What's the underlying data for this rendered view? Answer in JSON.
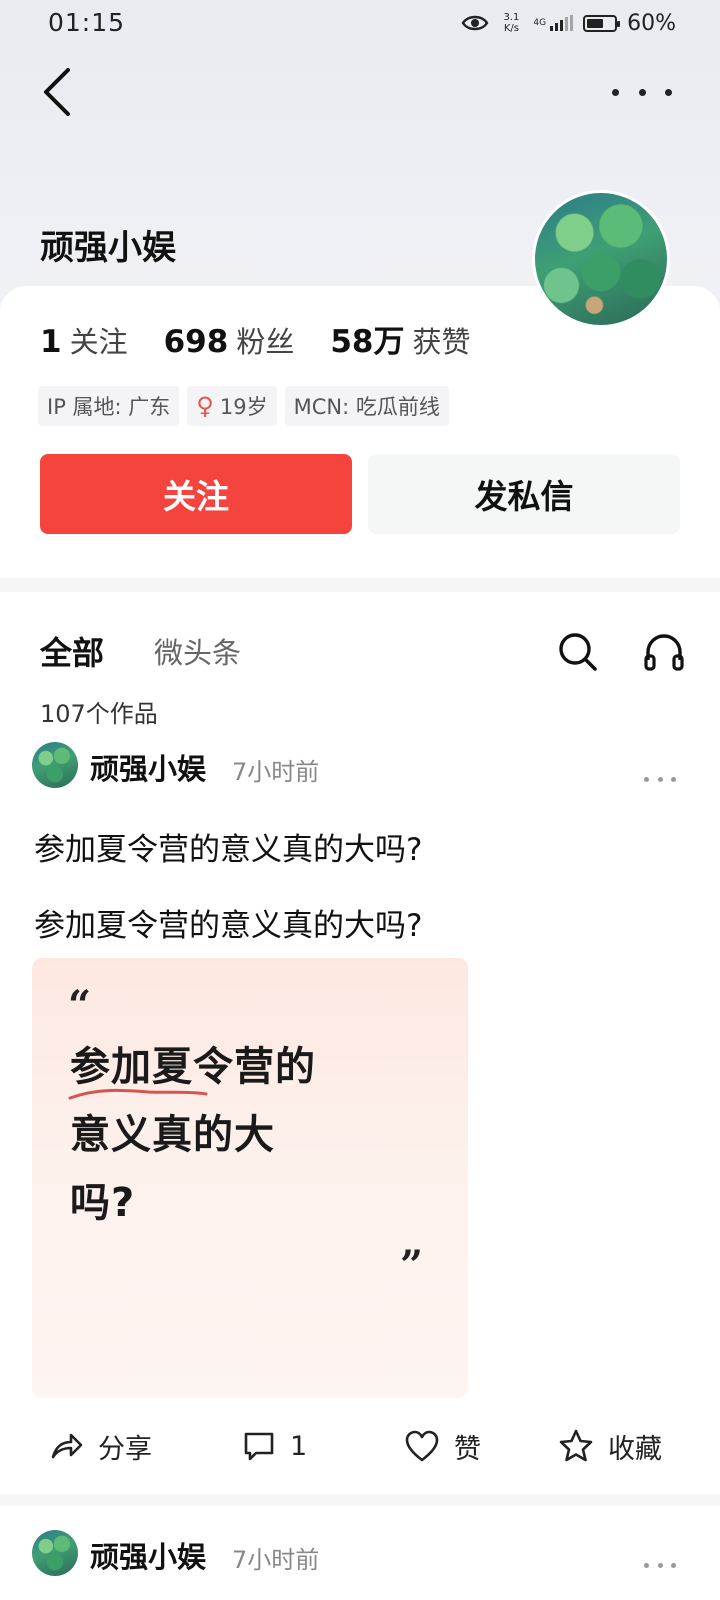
{
  "status_bar": {
    "time": "01:15",
    "net_speed_top": "3.1",
    "net_speed_bottom": "K/s",
    "network": "4G",
    "battery_level": 0.6,
    "battery_pct": "60%"
  },
  "icons": {
    "back": "chevron-left-icon",
    "more": "more-horizontal-icon",
    "search": "search-icon",
    "headset": "headphones-icon",
    "share": "share-icon",
    "comment": "comment-icon",
    "like": "heart-icon",
    "favorite": "star-icon"
  },
  "profile": {
    "name": "顽强小娱",
    "following_count": "1",
    "following_label": "关注",
    "fans_count": "698",
    "fans_label": "粉丝",
    "likes_count": "58万",
    "likes_label": "获赞",
    "tags": {
      "ip": "IP 属地: 广东",
      "age": "19岁",
      "mcn": "MCN: 吃瓜前线"
    },
    "follow_button": "关注",
    "message_button": "发私信"
  },
  "tabs": {
    "all": "全部",
    "micro": "微头条"
  },
  "works_count": "107个作品",
  "posts": [
    {
      "author": "顽强小娱",
      "time": "7小时前",
      "title": "参加夏令营的意义真的大吗?",
      "body": "参加夏令营的意义真的大吗?",
      "quote_open": "“",
      "quote_lines": [
        "参加夏令营的",
        "意义真的大",
        "吗?"
      ],
      "quote_close": "”",
      "actions": {
        "share": "分享",
        "comment_count": "1",
        "like": "赞",
        "favorite": "收藏"
      }
    },
    {
      "author": "顽强小娱",
      "time": "7小时前"
    }
  ],
  "colors": {
    "follow_red": "#f5433e",
    "accent_underline": "#d9534f",
    "female_icon": "#e8564f"
  }
}
